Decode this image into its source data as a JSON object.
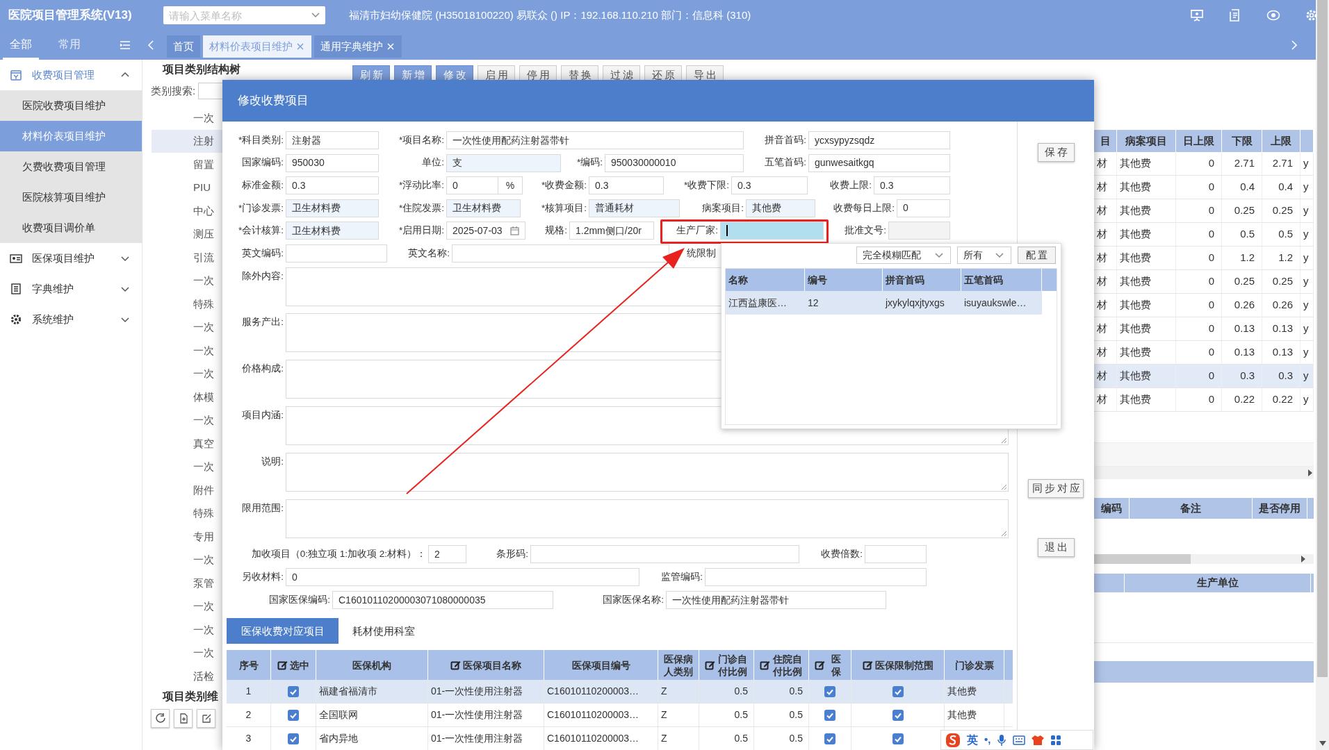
{
  "app": {
    "title": "医院项目管理系统(V13)",
    "menu_search": {
      "placeholder": "请输入菜单名称"
    },
    "info": "福清市妇幼保健院 (H35018100220) 易联众 () IP：192.168.110.210 部门：信息科 (310)"
  },
  "sidebar": {
    "tabs": [
      {
        "label": "全部",
        "selected": true
      },
      {
        "label": "常用",
        "selected": false
      }
    ],
    "groups": [
      {
        "label": "收费项目管理",
        "expanded": true,
        "children": [
          {
            "label": "医院收费项目维护",
            "selected": false
          },
          {
            "label": "材料价表项目维护",
            "selected": true
          },
          {
            "label": "欠费收费项目管理",
            "selected": false
          },
          {
            "label": "医院核算项目维护",
            "selected": false
          },
          {
            "label": "收费项目调价单",
            "selected": false
          }
        ]
      },
      {
        "label": "医保项目维护",
        "expanded": false
      },
      {
        "label": "字典维护",
        "expanded": false
      },
      {
        "label": "系统维护",
        "expanded": false
      }
    ]
  },
  "page_tabs": [
    {
      "label": "首页",
      "selected": false,
      "closable": false
    },
    {
      "label": "材料价表项目维护",
      "selected": true,
      "closable": true
    },
    {
      "label": "通用字典维护",
      "selected": false,
      "closable": true
    }
  ],
  "tree_panel": {
    "title": "项目类别结构树",
    "search_label": "类别搜索:",
    "items": [
      {
        "label": "一次",
        "selected": false
      },
      {
        "label": "注射",
        "selected": true
      },
      {
        "label": "留置",
        "selected": false
      },
      {
        "label": "PIU",
        "selected": false
      },
      {
        "label": "中心",
        "selected": false
      },
      {
        "label": "测压",
        "selected": false
      },
      {
        "label": "引流",
        "selected": false
      },
      {
        "label": "一次",
        "selected": false
      },
      {
        "label": "特殊",
        "selected": false
      },
      {
        "label": "一次",
        "selected": false
      },
      {
        "label": "一次",
        "selected": false
      },
      {
        "label": "一次",
        "selected": false
      },
      {
        "label": "体模",
        "selected": false
      },
      {
        "label": "一次",
        "selected": false
      },
      {
        "label": "真空",
        "selected": false
      },
      {
        "label": "一次",
        "selected": false
      },
      {
        "label": "附件",
        "selected": false
      },
      {
        "label": "特殊",
        "selected": false
      },
      {
        "label": "专用",
        "selected": false
      },
      {
        "label": "一次",
        "selected": false
      },
      {
        "label": "泵管",
        "selected": false
      },
      {
        "label": "一次",
        "selected": false
      },
      {
        "label": "一次",
        "selected": false
      },
      {
        "label": "一次",
        "selected": false
      },
      {
        "label": "活检",
        "selected": false
      }
    ],
    "footer_title": "项目类别维"
  },
  "toolbar": [
    {
      "label": "刷新",
      "primary": true
    },
    {
      "label": "新增",
      "primary": true
    },
    {
      "label": "修改",
      "primary": true
    },
    {
      "label": "启用",
      "primary": false
    },
    {
      "label": "停用",
      "primary": false
    },
    {
      "label": "替换",
      "primary": false
    },
    {
      "label": "过滤",
      "primary": false
    },
    {
      "label": "还原",
      "primary": false
    },
    {
      "label": "导出",
      "primary": false
    }
  ],
  "background_table": {
    "columns": [
      "目",
      "病案项目",
      "日上限",
      "下限",
      "上限"
    ],
    "rows": [
      {
        "selected": false,
        "cells": [
          "材",
          "其他费",
          "0",
          "2.71",
          "2.71",
          "y"
        ]
      },
      {
        "selected": false,
        "cells": [
          "材",
          "其他费",
          "0",
          "0.4",
          "0.4",
          "y"
        ]
      },
      {
        "selected": false,
        "cells": [
          "材",
          "其他费",
          "0",
          "0.25",
          "0.25",
          "y"
        ]
      },
      {
        "selected": false,
        "cells": [
          "材",
          "其他费",
          "0",
          "0.5",
          "0.5",
          "y"
        ]
      },
      {
        "selected": false,
        "cells": [
          "材",
          "其他费",
          "0",
          "1.2",
          "1.2",
          "y"
        ]
      },
      {
        "selected": false,
        "cells": [
          "材",
          "其他费",
          "0",
          "0.25",
          "0.25",
          "y"
        ]
      },
      {
        "selected": false,
        "cells": [
          "材",
          "其他费",
          "0",
          "0.26",
          "0.26",
          "y"
        ]
      },
      {
        "selected": false,
        "cells": [
          "材",
          "其他费",
          "0",
          "0.13",
          "0.13",
          "y"
        ]
      },
      {
        "selected": false,
        "cells": [
          "材",
          "其他费",
          "0",
          "0.13",
          "0.13",
          "y"
        ]
      },
      {
        "selected": true,
        "cells": [
          "材",
          "其他费",
          "0",
          "0.3",
          "0.3",
          "y"
        ]
      },
      {
        "selected": false,
        "cells": [
          "材",
          "其他费",
          "0",
          "0.22",
          "0.22",
          "y"
        ]
      }
    ]
  },
  "lower_sections": [
    {
      "columns": [
        "编码",
        "备注",
        "是否停用"
      ]
    },
    {
      "columns": [
        "生产单位"
      ]
    }
  ],
  "dialog": {
    "title": "修改收费项目",
    "form_rows": [
      [
        {
          "label": "*科目类别:",
          "value": "注射器",
          "kind": "input"
        },
        {
          "label": "*项目名称:",
          "value": "一次性使用配药注射器带针",
          "kind": "input"
        },
        {
          "label": "拼音首码:",
          "value": "ycxsypyzsqdz",
          "kind": "input"
        }
      ],
      [
        {
          "label": "国家编码:",
          "value": "950030",
          "kind": "input"
        },
        {
          "label": "单位:",
          "value": "支",
          "kind": "lookup"
        },
        {
          "label": "*编码:",
          "value": "950030000010",
          "kind": "input"
        },
        {
          "label": "五笔首码:",
          "value": "gunwesaitkgq",
          "kind": "input"
        }
      ],
      [
        {
          "label": "标准金额:",
          "value": "0.3",
          "kind": "input"
        },
        {
          "label": "*浮动比率:",
          "value": "0",
          "kind": "percent",
          "suffix": "%"
        },
        {
          "label": "*收费金额:",
          "value": "0.3",
          "kind": "input"
        },
        {
          "label": "*收费下限:",
          "value": "0.3",
          "kind": "input"
        },
        {
          "label": "收费上限:",
          "value": "0.3",
          "kind": "input"
        }
      ],
      [
        {
          "label": "*门诊发票:",
          "value": "卫生材料费",
          "kind": "lookup"
        },
        {
          "label": "*住院发票:",
          "value": "卫生材料费",
          "kind": "lookup"
        },
        {
          "label": "*核算项目:",
          "value": "普通耗材",
          "kind": "lookup"
        },
        {
          "label": "病案项目:",
          "value": "其他费",
          "kind": "lookup"
        },
        {
          "label": "收费每日上限:",
          "value": "0",
          "kind": "input"
        }
      ],
      [
        {
          "label": "*会计核算:",
          "value": "卫生材料费",
          "kind": "lookup"
        },
        {
          "label": "*启用日期:",
          "value": "2025-07-03",
          "kind": "date"
        },
        {
          "label": "规格:",
          "value": "1.2mm侧口/20r",
          "kind": "input"
        },
        {
          "label": "生产厂家:",
          "kind": "input",
          "focused": true,
          "highlighted": true
        },
        {
          "label": "批准文号:",
          "kind": "input",
          "disabled": true
        }
      ],
      [
        {
          "label": "英文编码:",
          "kind": "input"
        },
        {
          "label": "英文名称:",
          "kind": "input"
        },
        {
          "label": "统限制",
          "kind": "covered"
        }
      ]
    ],
    "text_areas": [
      {
        "label": "除外内容:"
      },
      {
        "label": "服务产出:"
      },
      {
        "label": "价格构成:"
      },
      {
        "label": "项目内涵:"
      },
      {
        "label": "说明:"
      },
      {
        "label": "限用范围:"
      }
    ],
    "lower_rows": [
      [
        {
          "label": "加收项目（0:独立项 1:加收项 2:材料）：",
          "value": "2",
          "kind": "input"
        },
        {
          "label": "条形码:",
          "kind": "input"
        },
        {
          "label": "收费倍数:",
          "kind": "input"
        }
      ],
      [
        {
          "label": "另收材料:",
          "value": "0",
          "kind": "input"
        },
        {
          "label": "监管编码:",
          "kind": "input"
        }
      ],
      [
        {
          "label": "国家医保编码:",
          "value": "C16010110200003071080000035",
          "kind": "input"
        },
        {
          "label": "国家医保名称:",
          "value": "一次性使用配药注射器带针",
          "kind": "input"
        }
      ]
    ],
    "buttons": [
      {
        "label": "保存"
      },
      {
        "label": "同步对应"
      },
      {
        "label": "退出"
      }
    ],
    "tabs": [
      {
        "label": "医保收费对应项目",
        "selected": true
      },
      {
        "label": "耗材使用科室",
        "selected": false
      }
    ],
    "table": {
      "columns": [
        {
          "label": "序号",
          "kind": "index",
          "editable": false
        },
        {
          "label": "选中",
          "kind": "check",
          "editable": true
        },
        {
          "label": "医保机构",
          "kind": "text",
          "editable": false
        },
        {
          "label": "医保项目名称",
          "kind": "text",
          "editable": true
        },
        {
          "label": "医保项目编号",
          "kind": "text",
          "editable": false
        },
        {
          "label": "医保病人类别",
          "kind": "text",
          "editable": false
        },
        {
          "label": "门诊自付比例",
          "kind": "number",
          "editable": true
        },
        {
          "label": "住院自付比例",
          "kind": "number",
          "editable": true
        },
        {
          "label": "医保",
          "kind": "check",
          "editable": true
        },
        {
          "label": "医保限制范围",
          "kind": "check",
          "editable": true
        },
        {
          "label": "门诊发票",
          "kind": "text",
          "editable": false
        }
      ],
      "rows": [
        {
          "selected": true,
          "cells": [
            "1",
            {
              "checked": true
            },
            "福建省福清市",
            "01-一次性使用注射器",
            "C16010110200003…",
            "Z",
            "0.5",
            "0.5",
            {
              "checked": true
            },
            {
              "checked": true
            },
            "其他费"
          ]
        },
        {
          "selected": false,
          "cells": [
            "2",
            {
              "checked": true
            },
            "全国联网",
            "01-一次性使用注射器",
            "C16010110200003…",
            "Z",
            "0.5",
            "0.5",
            {
              "checked": true
            },
            {
              "checked": true
            },
            "其他费"
          ]
        },
        {
          "selected": false,
          "cells": [
            "3",
            {
              "checked": true
            },
            "省内异地",
            "01-一次性使用注射器",
            "C16010110200003…",
            "Z",
            "0.5",
            "0.5",
            {
              "checked": true
            },
            {
              "checked": true
            }
          ]
        }
      ]
    },
    "lookup_popup": {
      "match_mode": "完全模糊匹配",
      "scope": "所有",
      "config_button": "配置",
      "columns": [
        "名称",
        "编号",
        "拼音首码",
        "五笔首码"
      ],
      "rows": [
        {
          "selected": true,
          "cells": [
            "江西益康医…",
            "12",
            "jxykylqxjtyxgs",
            "isuyaukswle…"
          ]
        }
      ]
    }
  },
  "ime_bar": {
    "mode": "英",
    "punct": "•,"
  }
}
